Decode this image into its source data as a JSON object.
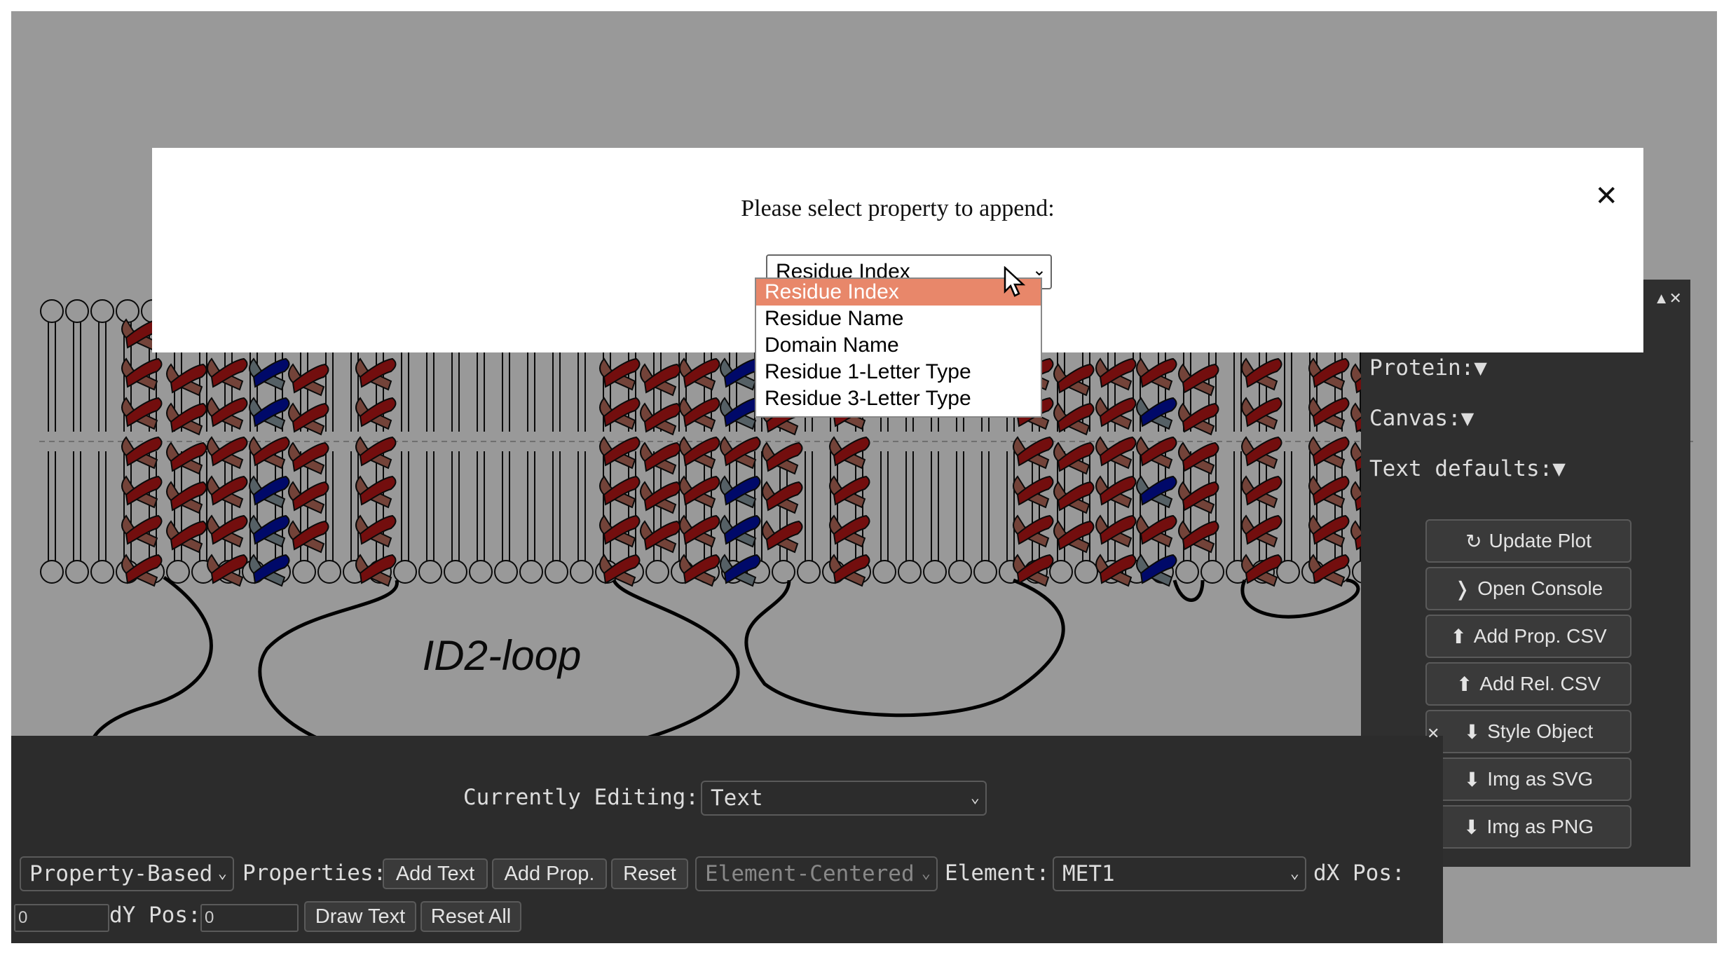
{
  "diagram": {
    "loop_label": "ID2-loop"
  },
  "colors": {
    "helix_red": "#c01818",
    "helix_blue": "#0010b0",
    "helix_band": "#c07060",
    "helix_band_blue": "#8ea0a8",
    "overlay": "rgba(0,0,0,0.4)",
    "selected_option": "#e8876a"
  },
  "side_panel": {
    "close_icon": "▲✕",
    "sections": [
      "Protein:▼",
      "Canvas:▼",
      "Text defaults:▼"
    ],
    "buttons": [
      {
        "icon": "↻",
        "label": "Update Plot"
      },
      {
        "icon": "❭",
        "label": "Open Console"
      },
      {
        "icon": "⬆",
        "label": "Add Prop. CSV"
      },
      {
        "icon": "⬆",
        "label": "Add Rel. CSV"
      },
      {
        "icon": "⬇",
        "label": "Style Object"
      },
      {
        "icon": "⬇",
        "label": "Img as SVG"
      },
      {
        "icon": "⬇",
        "label": "Img as PNG"
      }
    ]
  },
  "bottom_panel": {
    "close_icon": "✕",
    "currently_editing_label": "Currently Editing:",
    "currently_editing_value": "Text",
    "mode_select": "Property-Based",
    "properties_label": "Properties:",
    "add_text": "Add Text",
    "add_prop": "Add Prop.",
    "reset": "Reset",
    "anchor_select": "Element-Centered",
    "element_label": "Element:",
    "element_value": "MET1",
    "dx_label": "dX Pos:",
    "dx_value": "0",
    "dy_label": "dY Pos:",
    "dy_value": "0",
    "draw_text": "Draw Text",
    "reset_all": "Reset All"
  },
  "modal": {
    "title": "Please select property to append:",
    "close_icon": "✕",
    "selected": "Residue Index",
    "options": [
      "Residue Index",
      "Residue Name",
      "Domain Name",
      "Residue 1-Letter Type",
      "Residue 3-Letter Type"
    ]
  }
}
